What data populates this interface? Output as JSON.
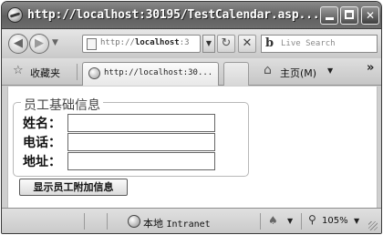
{
  "window": {
    "title": "http://localhost:30195/TestCalendar.asp...",
    "minimize_label": "",
    "maximize_label": "",
    "close_label": "✕"
  },
  "toolbar": {
    "back_glyph": "◀",
    "forward_glyph": "▶",
    "history_dropdown": "▼",
    "address_prefix": "http://",
    "address_host": "localhost",
    "address_suffix": ":3",
    "address_dropdown": "▼",
    "refresh_glyph": "↻",
    "stop_glyph": "✕",
    "search_logo": "b",
    "search_placeholder": "Live Search"
  },
  "favorites_bar": {
    "favorites_label": "收藏夹",
    "tab_title": "http://localhost:30...",
    "home_label": "主页(M)",
    "home_dropdown": "▼",
    "more_chevron": "»"
  },
  "form": {
    "legend": "员工基础信息",
    "name_label": "姓名：",
    "phone_label": "电话：",
    "address_label": "地址：",
    "name_value": "",
    "phone_value": "",
    "address_value": "",
    "submit_label": "显示员工附加信息"
  },
  "statusbar": {
    "zone_name": "本地",
    "zone_type": "Intranet",
    "protected_dropdown": "▼",
    "zoom": "105%",
    "zoom_dropdown": "▼"
  },
  "icons": {
    "app": "ie-logo-icon",
    "favorites": "star-icon",
    "home": "home-icon",
    "zone": "globe-icon",
    "zoom": "magnifier-icon"
  }
}
